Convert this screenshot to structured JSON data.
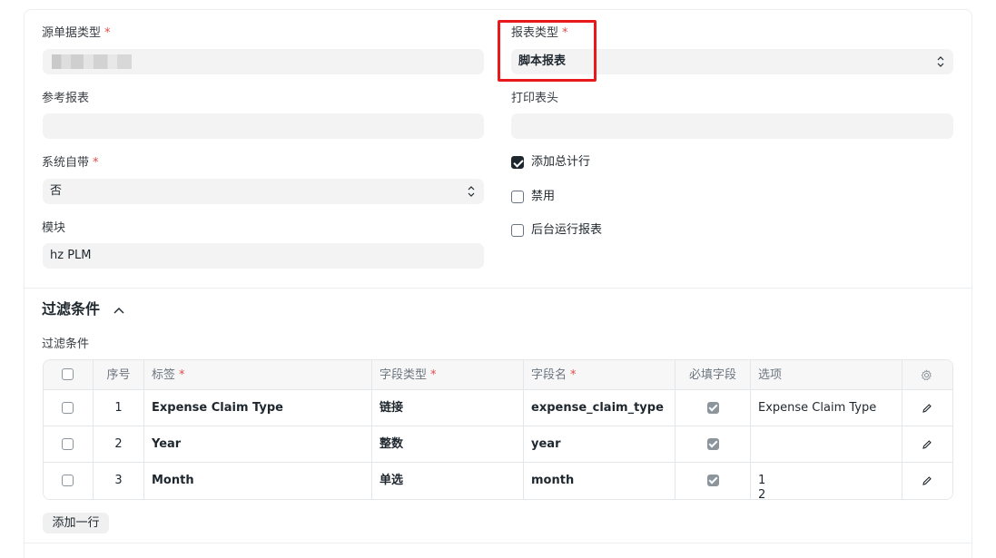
{
  "form": {
    "source_doctype": {
      "label": "源单据类型",
      "required_mark": "*"
    },
    "report_type": {
      "label": "报表类型",
      "required_mark": "*",
      "value": "脚本报表"
    },
    "ref_report": {
      "label": "参考报表",
      "value": ""
    },
    "print_header": {
      "label": "打印表头",
      "value": ""
    },
    "is_standard": {
      "label": "系统自带",
      "required_mark": "*",
      "value": "否"
    },
    "module": {
      "label": "模块",
      "value": "hz PLM"
    },
    "add_total_row": {
      "label": "添加总计行",
      "checked": true
    },
    "disabled": {
      "label": "禁用",
      "checked": false
    },
    "prepared_report": {
      "label": "后台运行报表",
      "checked": false
    }
  },
  "filters_section": {
    "title": "过滤条件",
    "field_label": "过滤条件",
    "columns": {
      "idx": "序号",
      "label": "标签",
      "label_req": "*",
      "fieldtype": "字段类型",
      "fieldtype_req": "*",
      "fieldname": "字段名",
      "fieldname_req": "*",
      "mandatory": "必填字段",
      "options": "选项"
    },
    "rows": [
      {
        "idx": "1",
        "label": "Expense Claim Type",
        "fieldtype": "链接",
        "fieldname": "expense_claim_type",
        "mandatory": true,
        "options": "Expense Claim Type"
      },
      {
        "idx": "2",
        "label": "Year",
        "fieldtype": "整数",
        "fieldname": "year",
        "mandatory": true,
        "options": ""
      },
      {
        "idx": "3",
        "label": "Month",
        "fieldtype": "单选",
        "fieldname": "month",
        "mandatory": true,
        "options": "1",
        "options_next": "2"
      }
    ],
    "add_row_label": "添加一行"
  },
  "icons": [
    "select-arrows-icon",
    "chevron-up-icon",
    "gear-icon",
    "pencil-icon",
    "checkbox-icon"
  ],
  "colors": {
    "highlight": "#e8191c",
    "required": "#e24c4c",
    "input_bg": "#f3f3f3"
  }
}
